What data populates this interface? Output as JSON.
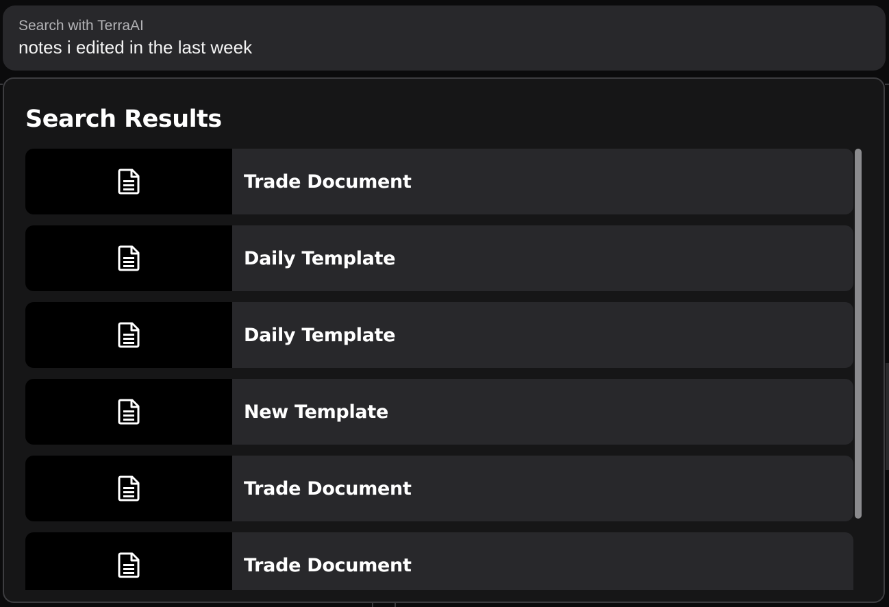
{
  "search": {
    "label": "Search with TerraAI",
    "query": "notes i edited in the last week",
    "placeholder": ""
  },
  "results": {
    "title": "Search Results",
    "items": [
      {
        "label": "Trade Document",
        "icon": "document-icon"
      },
      {
        "label": "Daily Template",
        "icon": "document-icon"
      },
      {
        "label": "Daily Template",
        "icon": "document-icon"
      },
      {
        "label": "New Template",
        "icon": "document-icon"
      },
      {
        "label": "Trade Document",
        "icon": "document-icon"
      },
      {
        "label": "Trade Document",
        "icon": "document-icon"
      }
    ]
  },
  "colors": {
    "background": "#0b0b0c",
    "panel": "#161617",
    "card": "#28282b",
    "thumbnail": "#000000",
    "text_primary": "#ffffff",
    "text_secondary": "#b3b3b6",
    "scrollbar": "#8b8b8e"
  }
}
